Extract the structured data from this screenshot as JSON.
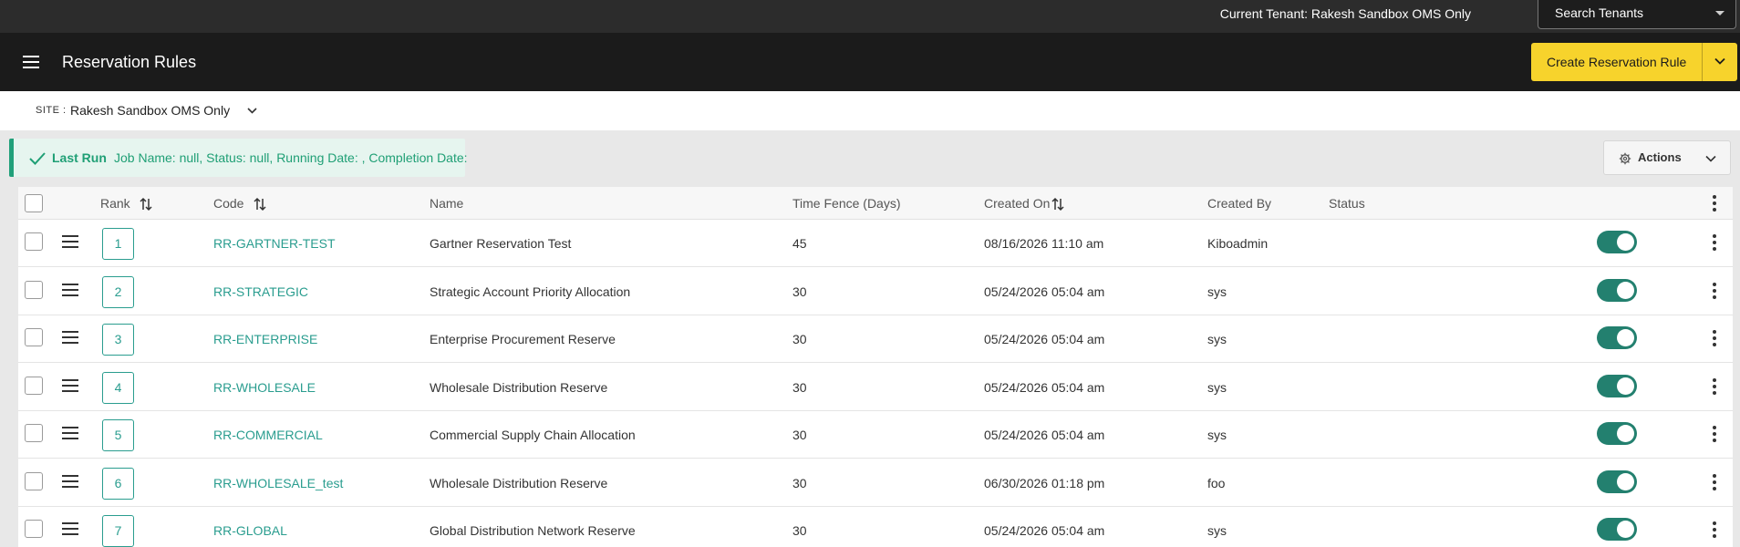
{
  "tenant_bar": {
    "current_tenant": "Current Tenant: Rakesh Sandbox OMS Only",
    "search_label": "Search Tenants"
  },
  "header": {
    "title": "Reservation Rules",
    "create_label": "Create Reservation Rule"
  },
  "site": {
    "label": "SITE :",
    "value": "Rakesh Sandbox OMS Only"
  },
  "last_run": {
    "title": "Last Run",
    "text": "Job Name: null, Status: null, Running Date: , Completion Date:"
  },
  "actions": {
    "label": "Actions"
  },
  "table": {
    "columns": {
      "rank": "Rank",
      "code": "Code",
      "name": "Name",
      "time_fence": "Time Fence (Days)",
      "created_on": "Created On",
      "created_by": "Created By",
      "status": "Status"
    },
    "rows": [
      {
        "rank": "1",
        "code": "RR-GARTNER-TEST",
        "name": "Gartner Reservation Test",
        "time_fence": "45",
        "created_on": "08/16/2026 11:10 am",
        "created_by": "Kiboadmin",
        "active": true
      },
      {
        "rank": "2",
        "code": "RR-STRATEGIC",
        "name": "Strategic Account Priority Allocation",
        "time_fence": "30",
        "created_on": "05/24/2026 05:04 am",
        "created_by": "sys",
        "active": true
      },
      {
        "rank": "3",
        "code": "RR-ENTERPRISE",
        "name": "Enterprise Procurement Reserve",
        "time_fence": "30",
        "created_on": "05/24/2026 05:04 am",
        "created_by": "sys",
        "active": true
      },
      {
        "rank": "4",
        "code": "RR-WHOLESALE",
        "name": "Wholesale Distribution Reserve",
        "time_fence": "30",
        "created_on": "05/24/2026 05:04 am",
        "created_by": "sys",
        "active": true
      },
      {
        "rank": "5",
        "code": "RR-COMMERCIAL",
        "name": "Commercial Supply Chain Allocation",
        "time_fence": "30",
        "created_on": "05/24/2026 05:04 am",
        "created_by": "sys",
        "active": true
      },
      {
        "rank": "6",
        "code": "RR-WHOLESALE_test",
        "name": "Wholesale Distribution Reserve",
        "time_fence": "30",
        "created_on": "06/30/2026 01:18 pm",
        "created_by": "foo",
        "active": true
      },
      {
        "rank": "7",
        "code": "RR-GLOBAL",
        "name": "Global Distribution Network Reserve",
        "time_fence": "30",
        "created_on": "05/24/2026 05:04 am",
        "created_by": "sys",
        "active": true
      }
    ]
  },
  "colors": {
    "accent": "#2a9d8f",
    "toggle_on": "#23806f",
    "create_button": "#f7d32c",
    "success": "#1f9f75"
  }
}
